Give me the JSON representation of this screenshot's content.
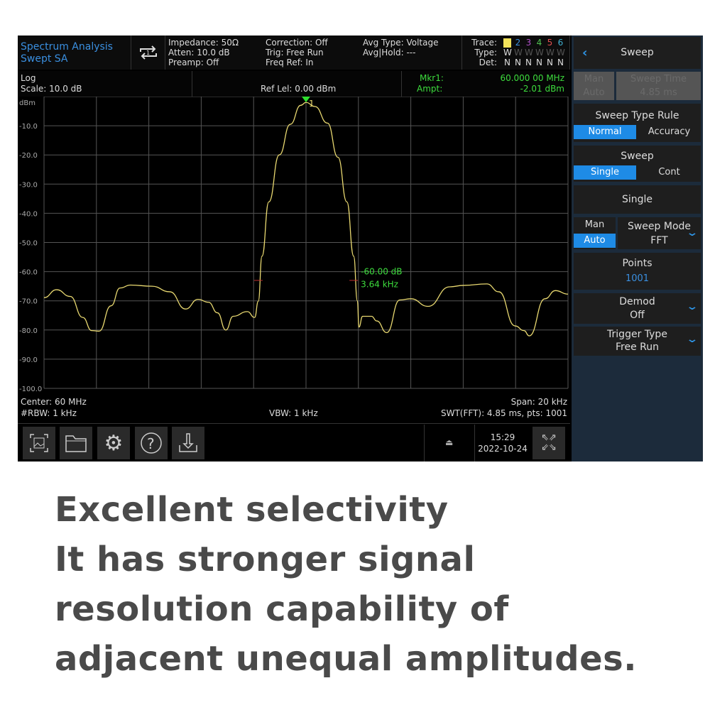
{
  "header": {
    "mode_line1": "Spectrum Analysis",
    "mode_line2": "Swept SA",
    "impedance": "Impedance: 50Ω",
    "atten": "Atten: 10.0 dB",
    "preamp": "Preamp: Off",
    "correction": "Correction: Off",
    "trig": "Trig: Free Run",
    "freq_ref": "Freq Ref: In",
    "avg_type": "Avg Type: Voltage",
    "avg_hold": "Avg|Hold: ---",
    "trace_label": "Trace:",
    "type_label": "Type:",
    "det_label": "Det:",
    "traces": [
      {
        "n": "1",
        "type": "W",
        "det": "N",
        "color": "#f2e25a"
      },
      {
        "n": "2",
        "type": "W",
        "det": "N",
        "color": "#3a8fe0"
      },
      {
        "n": "3",
        "type": "W",
        "det": "N",
        "color": "#b050c8"
      },
      {
        "n": "4",
        "type": "W",
        "det": "N",
        "color": "#50c050"
      },
      {
        "n": "5",
        "type": "W",
        "det": "N",
        "color": "#e05050"
      },
      {
        "n": "6",
        "type": "W",
        "det": "N",
        "color": "#40b0d0"
      }
    ]
  },
  "subheader": {
    "log": "Log",
    "scale": "Scale: 10.0 dB",
    "ref": "Ref Lel: 0.00 dBm",
    "mkr_label": "Mkr1:",
    "mkr_freq": "60.000 00 MHz",
    "ampt_label": "Ampt:",
    "ampt_value": "-2.01 dBm"
  },
  "plot": {
    "unit": "dBm",
    "y_ticks": [
      "-10.0",
      "-20.0",
      "-30.0",
      "-40.0",
      "-50.0",
      "-60.0",
      "-70.0",
      "-80.0",
      "-90.0",
      "-100.0"
    ],
    "marker_label": "1",
    "annot_db": "-60.00 dB",
    "annot_bw": "3.64 kHz",
    "trace_color": "#e8d870"
  },
  "chart_data": {
    "type": "line",
    "ylim": [
      -100,
      0
    ],
    "xlim_mhz": [
      59.99,
      60.01
    ],
    "grid": true,
    "x_mhz": [
      59.99,
      59.99048,
      59.991,
      59.99148,
      59.99182,
      59.9921,
      59.99256,
      59.9929,
      59.9933,
      59.99412,
      59.9948,
      59.9954,
      59.99588,
      59.99628,
      59.99662,
      59.99694,
      59.99722,
      59.99776,
      59.99804,
      59.99818,
      59.99832,
      59.99858,
      59.99898,
      59.9994,
      59.9998,
      60.0,
      60.00034,
      60.00082,
      60.00122,
      60.00156,
      60.00182,
      60.00196,
      60.00202,
      60.00216,
      60.0025,
      60.0027,
      60.00308,
      60.00358,
      60.004,
      60.00466,
      60.00548,
      60.00602,
      60.0069,
      60.00736,
      60.00798,
      60.00832,
      60.00852,
      60.00912,
      60.00952,
      60.01
    ],
    "y_dbm": [
      -68.9,
      -66.2,
      -68.5,
      -75.7,
      -80.2,
      -80.4,
      -71.7,
      -65.6,
      -64.6,
      -65.0,
      -66.9,
      -72.8,
      -69.5,
      -70.5,
      -74.1,
      -80.0,
      -75.3,
      -73.7,
      -75.7,
      -70.1,
      -54.7,
      -36.1,
      -20.0,
      -9.5,
      -3.0,
      -2.01,
      -3.4,
      -9.1,
      -20.8,
      -36.1,
      -54.7,
      -70.0,
      -79.0,
      -75.3,
      -75.3,
      -76.9,
      -80.9,
      -69.7,
      -69.3,
      -71.9,
      -65.2,
      -64.7,
      -64.2,
      -66.9,
      -78.6,
      -80.2,
      -82.0,
      -69.3,
      -66.5,
      -67.7
    ],
    "bw_markers_mhz": [
      59.99818,
      60.00182
    ],
    "bw_marker_level_dbm": -63
  },
  "footer": {
    "center": "Center: 60 MHz",
    "rbw": "#RBW: 1 kHz",
    "vbw": "VBW: 1 kHz",
    "span": "Span: 20 kHz",
    "swt": "SWT(FFT): 4.85 ms, pts: 1001",
    "time": "15:29",
    "date": "2022-10-24"
  },
  "panel": {
    "title": "Sweep",
    "man": "Man",
    "auto": "Auto",
    "sweep_time": "Sweep Time",
    "sweep_time_value": "4.85 ms",
    "type_rule": "Sweep Type Rule",
    "normal": "Normal",
    "accuracy": "Accuracy",
    "sweep": "Sweep",
    "single": "Single",
    "cont": "Cont",
    "single_btn": "Single",
    "mode_man": "Man",
    "mode_auto": "Auto",
    "sweep_mode": "Sweep Mode",
    "sweep_mode_value": "FFT",
    "points": "Points",
    "points_value": "1001",
    "demod": "Demod",
    "demod_value": "Off",
    "trigger": "Trigger Type",
    "trigger_value": "Free Run"
  },
  "caption": {
    "line1": "Excellent selectivity",
    "line2": "It has stronger signal",
    "line3": "resolution capability of",
    "line4": "adjacent unequal amplitudes."
  }
}
